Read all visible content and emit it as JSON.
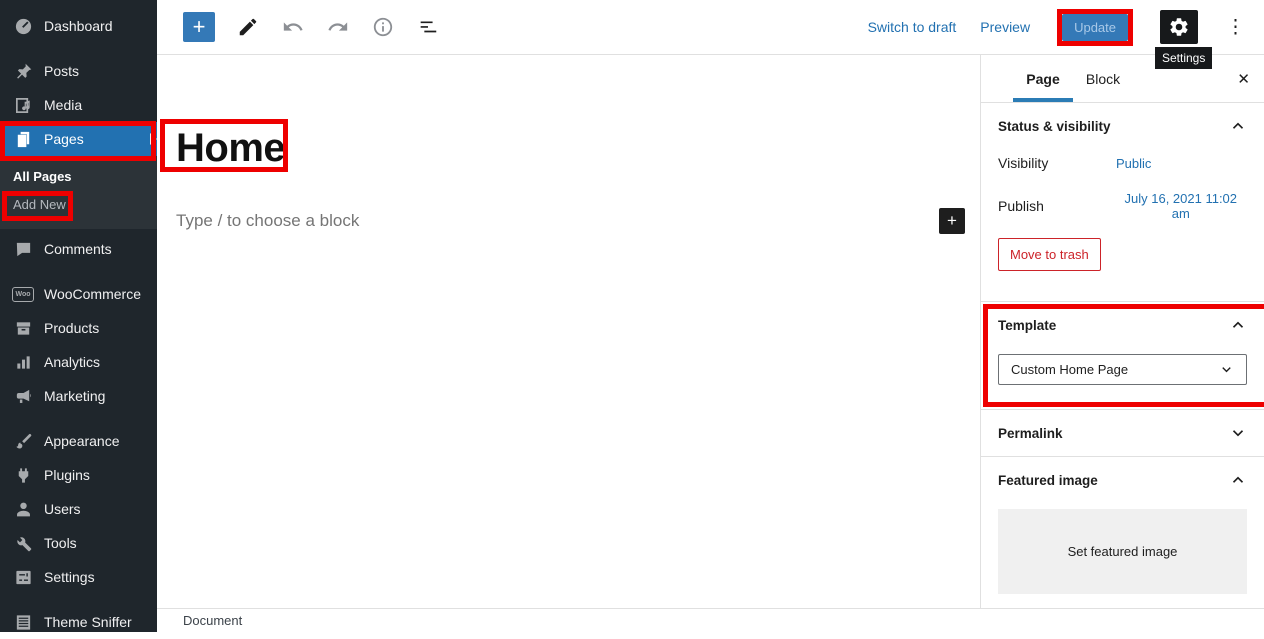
{
  "colors": {
    "annotation_red": "#ee0000",
    "accent_blue": "#3479b7",
    "link_blue": "#2271b1",
    "sidebar_bg": "#1f262c",
    "sidebar_highlight": "#2271b1",
    "destructive_red": "#cc2329"
  },
  "icons": {
    "plus": "+",
    "close": "✕",
    "more": "⋮"
  },
  "admin_sidebar": {
    "items": [
      {
        "label": "Dashboard",
        "icon": "dashboard-icon"
      },
      {
        "label": "Posts",
        "icon": "pin-icon"
      },
      {
        "label": "Media",
        "icon": "media-icon"
      },
      {
        "label": "Pages",
        "icon": "pages-icon"
      },
      {
        "label": "Comments",
        "icon": "comment-icon"
      },
      {
        "label": "WooCommerce",
        "icon": "woocommerce-icon"
      },
      {
        "label": "Products",
        "icon": "products-box-icon"
      },
      {
        "label": "Analytics",
        "icon": "bar-chart-icon"
      },
      {
        "label": "Marketing",
        "icon": "megaphone-icon"
      },
      {
        "label": "Appearance",
        "icon": "brush-icon"
      },
      {
        "label": "Plugins",
        "icon": "plug-icon"
      },
      {
        "label": "Users",
        "icon": "person-icon"
      },
      {
        "label": "Tools",
        "icon": "wrench-icon"
      },
      {
        "label": "Settings",
        "icon": "sliders-icon"
      },
      {
        "label": "Theme Sniffer",
        "icon": "list-doc-icon"
      }
    ],
    "woo_badge": "Woo",
    "submenu": {
      "all_pages": "All Pages",
      "add_new": "Add New"
    }
  },
  "toolbar": {
    "switch_to_draft": "Switch to draft",
    "preview": "Preview",
    "update": "Update",
    "settings_tooltip": "Settings"
  },
  "editor": {
    "title": "Home",
    "block_placeholder": "Type / to choose a block"
  },
  "panel": {
    "tabs": {
      "page": "Page",
      "block": "Block"
    },
    "status": {
      "title": "Status & visibility",
      "visibility_label": "Visibility",
      "visibility_value": "Public",
      "publish_label": "Publish",
      "publish_value": "July 16, 2021 11:02 am",
      "move_to_trash": "Move to trash"
    },
    "template": {
      "title": "Template",
      "selected": "Custom Home Page"
    },
    "permalink": {
      "title": "Permalink"
    },
    "featured": {
      "title": "Featured image",
      "set_label": "Set featured image"
    }
  },
  "footer": {
    "document": "Document"
  }
}
